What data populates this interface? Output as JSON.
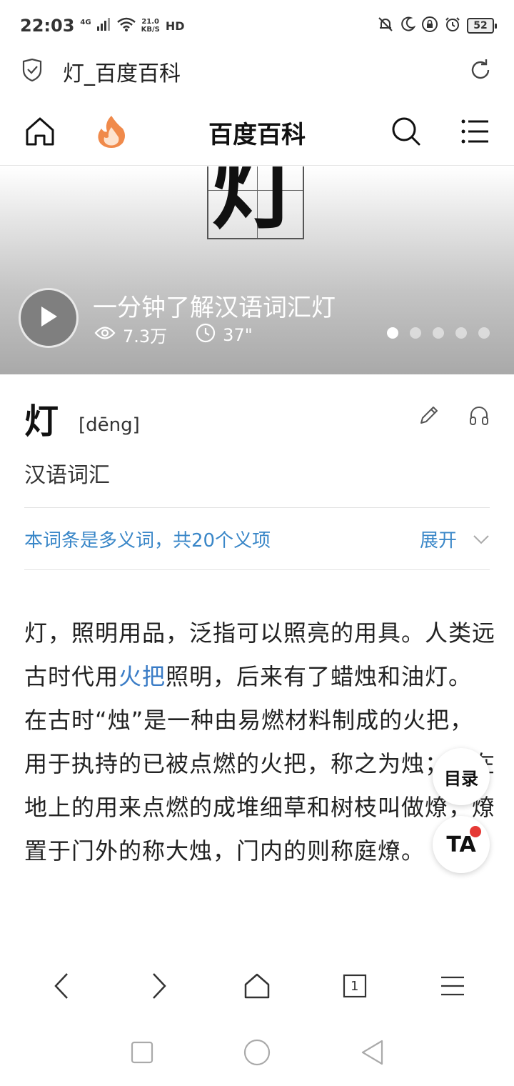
{
  "status_bar": {
    "time": "22:03",
    "network": "4G",
    "speed_value": "21.0",
    "speed_unit": "KB/S",
    "hd": "HD",
    "battery": "52"
  },
  "address_bar": {
    "title": "灯_百度百科"
  },
  "site_header": {
    "title": "百度百科"
  },
  "banner": {
    "character": "灯",
    "video_title": "一分钟了解汉语词汇灯",
    "views": "7.3万",
    "duration": "37\"",
    "slides": 5,
    "active_slide": 1
  },
  "entry": {
    "title": "灯",
    "pinyin": "[dēng]",
    "subtitle": "汉语词汇"
  },
  "polysemy": {
    "text": "本词条是多义词，共20个义项",
    "expand_label": "展开"
  },
  "content": {
    "part1": "灯，照明用品，泛指可以照亮的用具。人类远古时代用",
    "link": "火把",
    "part2": "照明，后来有了蜡烛和油灯。在古时“烛”是一种由易燃材料制成的火把，用于执持的已被点燃的火把，称之为烛；放在地上的用来点燃的成堆细草和树枝叫做燎，燎置于门外的称大烛，门内的则称庭燎。"
  },
  "floating": {
    "toc_label": "目录",
    "ta_label": "TA"
  },
  "toolbar": {
    "tabs_count": "1"
  },
  "colors": {
    "link_blue": "#3a87c8",
    "badge_red": "#e53935",
    "flame_orange": "#f08a4b"
  }
}
